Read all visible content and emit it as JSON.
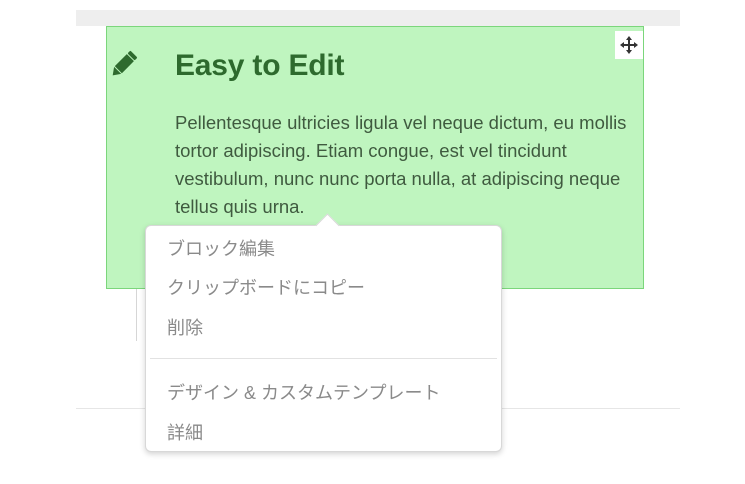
{
  "block": {
    "title": "Easy to Edit",
    "body": "Pellentesque ultricies ligula vel neque dictum, eu mollis tortor adipiscing. Etiam congue, est vel tincidunt vestibulum, nunc nunc porta nulla, at adipiscing neque tellus quis urna.",
    "icon": "pencil-icon",
    "handle_icon": "move-icon"
  },
  "context_menu": {
    "items": [
      {
        "label": "ブロック編集"
      },
      {
        "label": "クリップボードにコピー"
      },
      {
        "label": "削除"
      },
      {
        "label": "デザイン & カスタムテンプレート"
      },
      {
        "label": "詳細"
      }
    ]
  },
  "colors": {
    "block_background": "#bff5bf",
    "block_border": "#7bd67b",
    "title_color": "#2e6a2e",
    "menu_text": "#8a8a8a"
  }
}
